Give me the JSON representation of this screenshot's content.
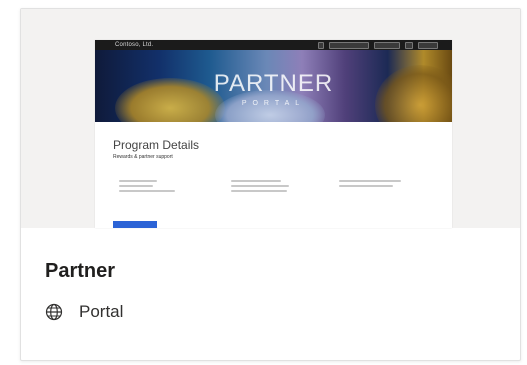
{
  "card": {
    "title": "Partner",
    "meta_label": "Portal",
    "meta_icon": "globe-icon"
  },
  "thumbnail": {
    "company": "Contoso, Ltd.",
    "hero_title": "PARTNER",
    "hero_subtitle": "PORTAL",
    "section_heading": "Program Details",
    "section_subheading": "Rewards & partner support",
    "accent_color": "#2b63d6"
  }
}
